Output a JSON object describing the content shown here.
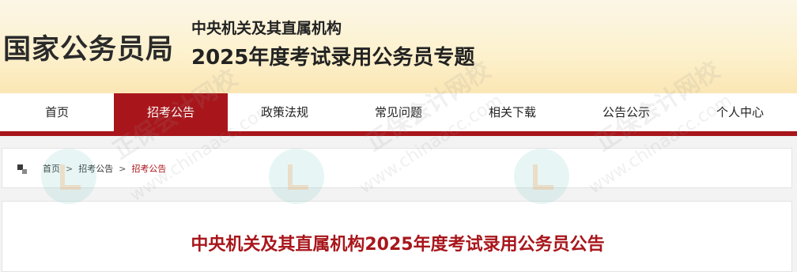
{
  "header": {
    "site_title": "国家公务员局",
    "org_name": "中央机关及其直属机构",
    "topic_title": "2025年度考试录用公务员专题"
  },
  "nav": {
    "items": [
      {
        "label": "首页"
      },
      {
        "label": "招考公告",
        "active": true
      },
      {
        "label": "政策法规"
      },
      {
        "label": "常见问题"
      },
      {
        "label": "相关下载"
      },
      {
        "label": "公告公示"
      },
      {
        "label": "个人中心"
      }
    ]
  },
  "breadcrumb": {
    "icon": "grid-icon",
    "items": [
      "首页",
      "招考公告",
      "招考公告"
    ],
    "separator": ">"
  },
  "article": {
    "title": "中央机关及其直属机构2025年度考试录用公务员公告"
  },
  "watermark": {
    "text": "正保会计网校",
    "url": "www.chinaacc.com"
  },
  "colors": {
    "accent": "#a8161b",
    "header_bg": "#fdf2cf"
  }
}
